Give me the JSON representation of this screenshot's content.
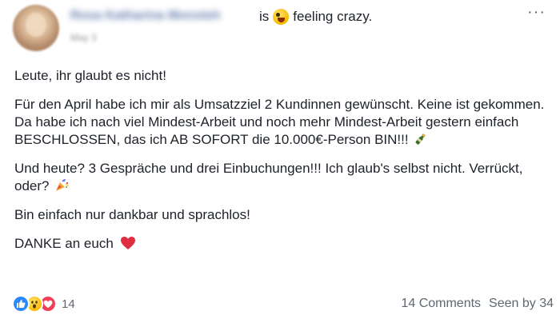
{
  "header": {
    "author_name": "Rosa Katharina Monsteh",
    "date": "May 3",
    "feeling_prefix": "is",
    "feeling_icon": "crazy-face-emoji",
    "feeling_text": "feeling crazy.",
    "more_label": "···"
  },
  "post": {
    "paragraphs": [
      {
        "text": "Leute, ihr glaubt es nicht!"
      },
      {
        "text": "Für den April habe ich mir als Umsatzziel 2 Kundinnen gewünscht. Keine ist gekommen. Da habe ich nach viel Mindest-Arbeit und noch mehr Mindest-Arbeit gestern einfach BESCHLOSSEN, das ich AB SOFORT die 10.000€-Person BIN!!!",
        "icon": "champagne-bottle-icon"
      },
      {
        "text": "Und heute? 3 Gespräche und drei Einbuchungen!!! Ich glaub's selbst nicht. Verrückt, oder?",
        "icon": "party-popper-icon"
      },
      {
        "text": "Bin einfach nur dankbar und sprachlos!"
      },
      {
        "text": "DANKE an euch",
        "icon": "red-heart-icon"
      }
    ]
  },
  "footer": {
    "reaction_icons": [
      "like-icon",
      "wow-icon",
      "love-icon"
    ],
    "reaction_count": "14",
    "comments": "14 Comments",
    "seen": "Seen by 34"
  },
  "colors": {
    "like": "#2d88ff",
    "love": "#f33e58",
    "wow": "#f7b900",
    "text": "#1d2129",
    "secondary": "#606770"
  }
}
